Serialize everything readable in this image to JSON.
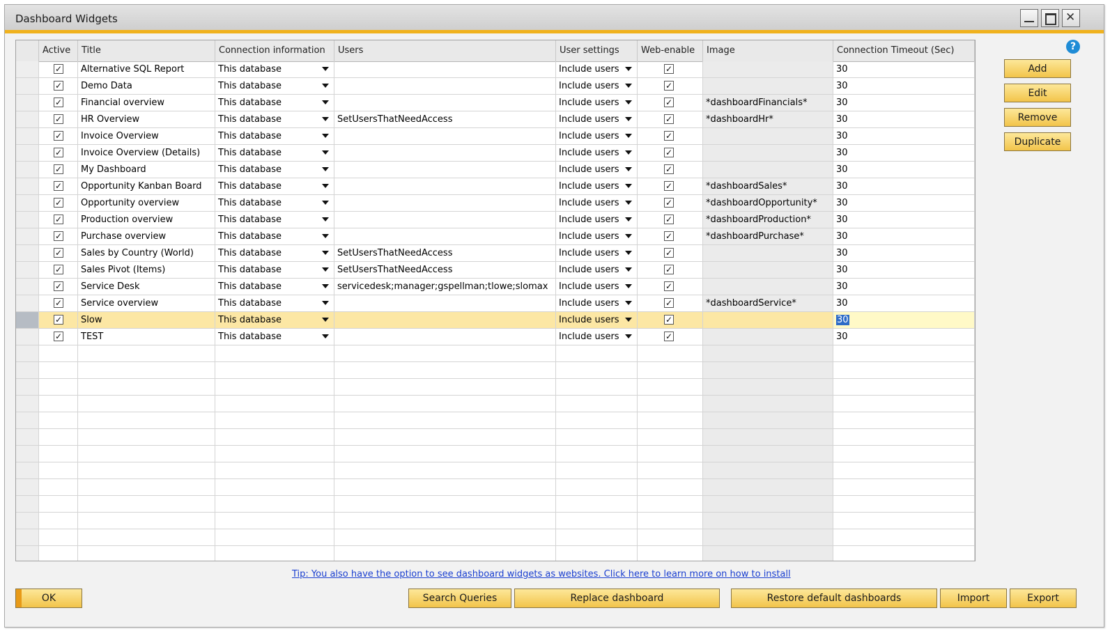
{
  "window": {
    "title": "Dashboard Widgets"
  },
  "table": {
    "headers": [
      "",
      "Active",
      "Title",
      "Connection information",
      "Users",
      "User settings",
      "Web-enable",
      "Image",
      "Connection Timeout (Sec)"
    ],
    "rows": [
      {
        "active": true,
        "title": "Alternative SQL Report",
        "connection": "This database",
        "users": "",
        "user_settings": "Include users",
        "web_enable": true,
        "image": "",
        "timeout": "30"
      },
      {
        "active": true,
        "title": "Demo Data",
        "connection": "This database",
        "users": "",
        "user_settings": "Include users",
        "web_enable": true,
        "image": "",
        "timeout": "30"
      },
      {
        "active": true,
        "title": "Financial overview",
        "connection": "This database",
        "users": "",
        "user_settings": "Include users",
        "web_enable": true,
        "image": "*dashboardFinancials*",
        "timeout": "30"
      },
      {
        "active": true,
        "title": "HR Overview",
        "connection": "This database",
        "users": "SetUsersThatNeedAccess",
        "user_settings": "Include users",
        "web_enable": true,
        "image": "*dashboardHr*",
        "timeout": "30"
      },
      {
        "active": true,
        "title": "Invoice Overview",
        "connection": "This database",
        "users": "",
        "user_settings": "Include users",
        "web_enable": true,
        "image": "",
        "timeout": "30"
      },
      {
        "active": true,
        "title": "Invoice Overview (Details)",
        "connection": "This database",
        "users": "",
        "user_settings": "Include users",
        "web_enable": true,
        "image": "",
        "timeout": "30"
      },
      {
        "active": true,
        "title": "My Dashboard",
        "connection": "This database",
        "users": "",
        "user_settings": "Include users",
        "web_enable": true,
        "image": "",
        "timeout": "30"
      },
      {
        "active": true,
        "title": "Opportunity Kanban Board",
        "connection": "This database",
        "users": "",
        "user_settings": "Include users",
        "web_enable": true,
        "image": "*dashboardSales*",
        "timeout": "30"
      },
      {
        "active": true,
        "title": "Opportunity overview",
        "connection": "This database",
        "users": "",
        "user_settings": "Include users",
        "web_enable": true,
        "image": "*dashboardOpportunity*",
        "timeout": "30"
      },
      {
        "active": true,
        "title": "Production overview",
        "connection": "This database",
        "users": "",
        "user_settings": "Include users",
        "web_enable": true,
        "image": "*dashboardProduction*",
        "timeout": "30"
      },
      {
        "active": true,
        "title": "Purchase overview",
        "connection": "This database",
        "users": "",
        "user_settings": "Include users",
        "web_enable": true,
        "image": "*dashboardPurchase*",
        "timeout": "30"
      },
      {
        "active": true,
        "title": "Sales by Country (World)",
        "connection": "This database",
        "users": "SetUsersThatNeedAccess",
        "user_settings": "Include users",
        "web_enable": true,
        "image": "",
        "timeout": "30"
      },
      {
        "active": true,
        "title": "Sales Pivot (Items)",
        "connection": "This database",
        "users": "SetUsersThatNeedAccess",
        "user_settings": "Include users",
        "web_enable": true,
        "image": "",
        "timeout": "30"
      },
      {
        "active": true,
        "title": "Service Desk",
        "connection": "This database",
        "users": "servicedesk;manager;gspellman;tlowe;slomax",
        "user_settings": "Include users",
        "web_enable": true,
        "image": "",
        "timeout": "30"
      },
      {
        "active": true,
        "title": "Service overview",
        "connection": "This database",
        "users": "",
        "user_settings": "Include users",
        "web_enable": true,
        "image": "*dashboardService*",
        "timeout": "30"
      },
      {
        "active": true,
        "title": "Slow",
        "connection": "This database",
        "users": "",
        "user_settings": "Include users",
        "web_enable": true,
        "image": "",
        "timeout": "30",
        "selected": true
      },
      {
        "active": true,
        "title": "TEST",
        "connection": "This database",
        "users": "",
        "user_settings": "Include users",
        "web_enable": true,
        "image": "",
        "timeout": "30"
      }
    ],
    "empty_rows": 13
  },
  "side_buttons": {
    "add": "Add",
    "edit": "Edit",
    "remove": "Remove",
    "duplicate": "Duplicate"
  },
  "tip": "Tip: You also have the option to see dashboard widgets as websites. Click here to learn more on how to install",
  "bottom_buttons": {
    "ok": "OK",
    "search_queries": "Search Queries",
    "replace_dashboard": "Replace dashboard",
    "restore_defaults": "Restore default dashboards",
    "import": "Import",
    "export": "Export"
  },
  "icons": {
    "help": "help-icon",
    "check": "✓"
  },
  "colors": {
    "accent": "#f0b21e",
    "button": "#f2c44a",
    "selected_row": "#fce7a4",
    "link": "#1a3fd0"
  }
}
